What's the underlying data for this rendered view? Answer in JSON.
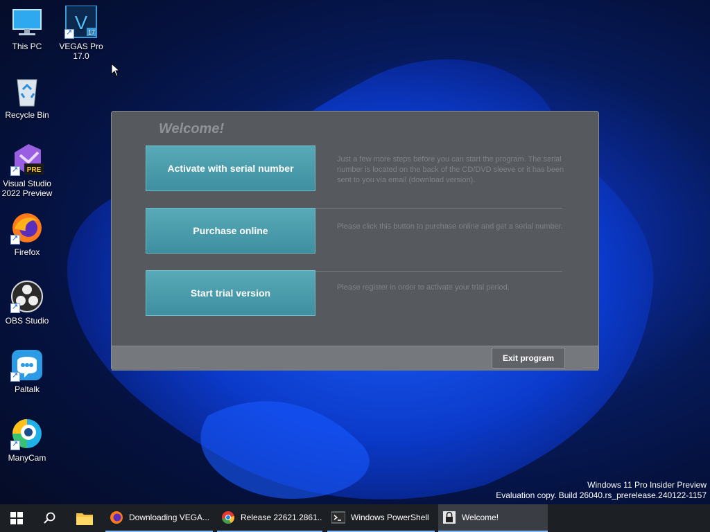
{
  "desktop": {
    "icons": [
      {
        "label": "This PC",
        "icon": "monitor-icon"
      },
      {
        "label": "VEGAS Pro 17.0",
        "icon": "vegas-pro-icon",
        "badge": "17",
        "letter": "V"
      },
      {
        "label": "Recycle Bin",
        "icon": "recycle-bin-icon"
      },
      {
        "label": "Visual Studio 2022 Preview",
        "icon": "visual-studio-icon",
        "badge": "PRE"
      },
      {
        "label": "Firefox",
        "icon": "firefox-icon"
      },
      {
        "label": "OBS Studio",
        "icon": "obs-icon"
      },
      {
        "label": "Paltalk",
        "icon": "paltalk-icon"
      },
      {
        "label": "ManyCam",
        "icon": "manycam-icon"
      }
    ]
  },
  "dialog": {
    "title": "Welcome!",
    "options": [
      {
        "label": "Activate with serial number",
        "description": "Just a few more steps before you can start the program. The serial number is located on the back of the CD/DVD sleeve or it has been sent to you via email (download version)."
      },
      {
        "label": "Purchase online",
        "description": "Please click this button to purchase online and get a serial number."
      },
      {
        "label": "Start trial version",
        "description": "Please register in order to activate your trial period."
      }
    ],
    "exit_label": "Exit program"
  },
  "watermark": {
    "line1": "Windows 11 Pro Insider Preview",
    "line2": "Evaluation copy. Build 26040.rs_prerelease.240122-1157"
  },
  "taskbar": {
    "start_icon": "windows-start-icon",
    "search_icon": "search-icon",
    "explorer_icon": "file-explorer-icon",
    "apps": [
      {
        "label": "Downloading VEGA...",
        "icon": "firefox-icon"
      },
      {
        "label": "Release 22621.2861....",
        "icon": "chrome-icon"
      },
      {
        "label": "Windows PowerShell",
        "icon": "powershell-icon"
      },
      {
        "label": "Welcome!",
        "icon": "lock-icon"
      }
    ]
  },
  "colors": {
    "accent": "#4aa0b0",
    "dialog_bg": "#56595d",
    "taskbar_bg": "#1c1f24"
  }
}
